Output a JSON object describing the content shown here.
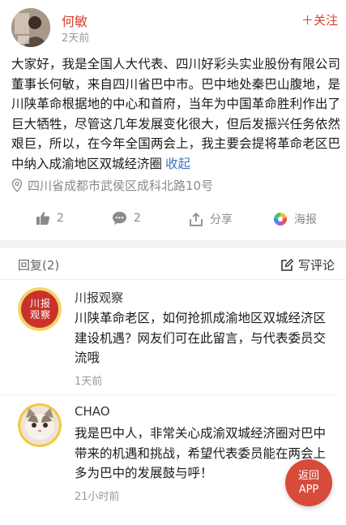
{
  "post": {
    "author_name": "何敏",
    "time": "2天前",
    "follow_label": "＋关注",
    "text": "大家好，我是全国人大代表、四川好彩头实业股份有限公司董事长何敏，来自四川省巴中市。巴中地处秦巴山腹地，是川陕革命根据地的中心和首府，当年为中国革命胜利作出了巨大牺牲，尽管这几年发展变化很大，但后发振兴任务依然艰巨，所以，在今年全国两会上，我主要会提将革命老区巴中纳入成渝地区双城经济圈",
    "collapse_label": "收起",
    "location": "四川省成都市武侯区成科北路10号",
    "actions": {
      "like_icon": "thumbs-up-icon",
      "like_count": "2",
      "comment_icon": "comment-icon",
      "comment_count": "2",
      "share_icon": "share-icon",
      "share_label": "分享",
      "poster_icon": "poster-icon",
      "poster_label": "海报"
    }
  },
  "replies": {
    "header": "回复(2)",
    "write_label": "写评论",
    "items": [
      {
        "name": "川报观察",
        "avatar_text": "川报观察",
        "text": "川陕革命老区，如何抢抓成渝地区双城经济区建设机遇？网友们可在此留言，与代表委员交流哦",
        "time": "1天前"
      },
      {
        "name": "CHAO",
        "text": "我是巴中人，非常关心成渝双城经济圈对巴中带来的机遇和挑战，希望代表委员能在两会上多为巴中的发展鼓与呼！",
        "time": "21小时前"
      }
    ]
  },
  "float_button": {
    "line1": "返回",
    "line2": "APP"
  },
  "colors": {
    "accent": "#d6412f",
    "link": "#3e73c7",
    "muted": "#8a8a8a"
  }
}
